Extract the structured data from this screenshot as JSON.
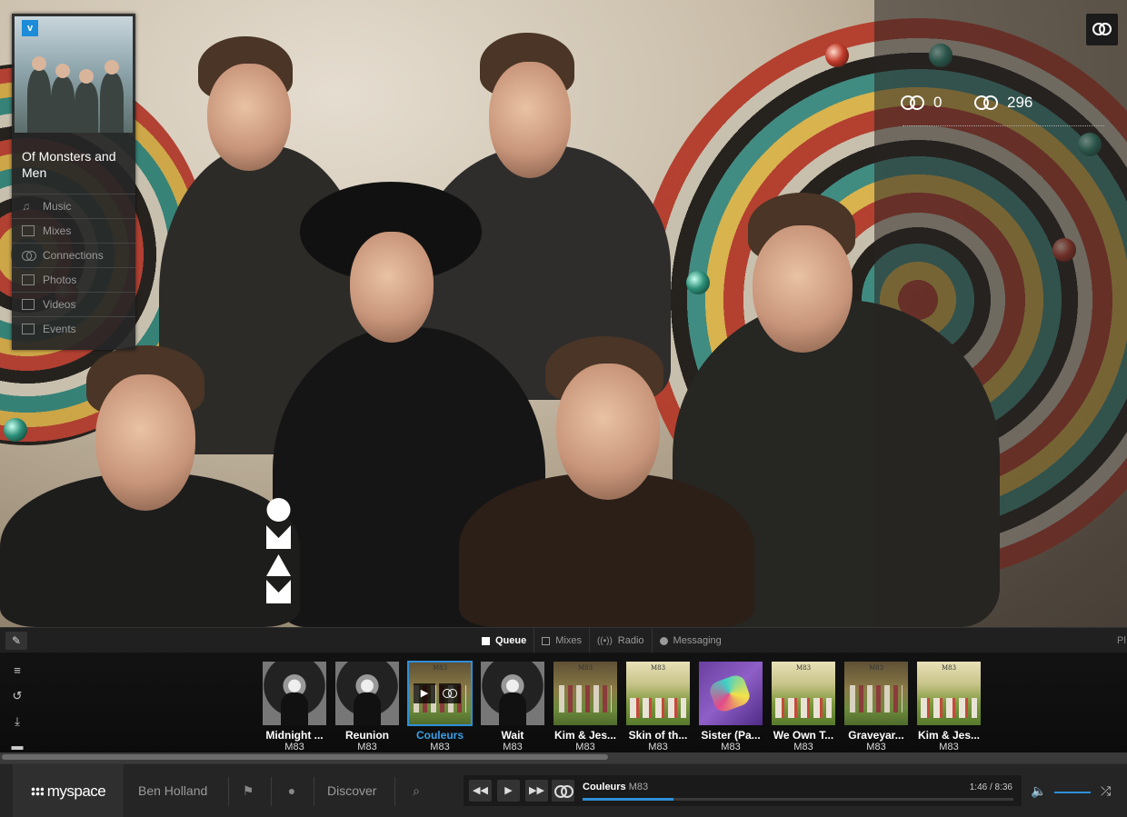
{
  "artist": {
    "name": "Of Monsters and Men",
    "verified_badge": "v",
    "nav": [
      {
        "label": "Music",
        "icon": "music-note-icon"
      },
      {
        "label": "Mixes",
        "icon": "mix-icon"
      },
      {
        "label": "Connections",
        "icon": "connections-icon"
      },
      {
        "label": "Photos",
        "icon": "photo-icon"
      },
      {
        "label": "Videos",
        "icon": "video-icon"
      },
      {
        "label": "Events",
        "icon": "calendar-icon"
      }
    ]
  },
  "stats": {
    "connections_left": "0",
    "connections_right": "296"
  },
  "panel": {
    "tabs": [
      {
        "label": "Queue",
        "active": true
      },
      {
        "label": "Mixes",
        "active": false
      },
      {
        "label": "Radio",
        "active": false
      },
      {
        "label": "Messaging",
        "active": false
      }
    ],
    "overflow_label": "Pl"
  },
  "queue": [
    {
      "title": "Midnight ...",
      "artist": "M83",
      "cover": "bw"
    },
    {
      "title": "Reunion",
      "artist": "M83",
      "cover": "bw"
    },
    {
      "title": "Couleurs",
      "artist": "M83",
      "cover": "field",
      "current": true
    },
    {
      "title": "Wait",
      "artist": "M83",
      "cover": "bw"
    },
    {
      "title": "Kim & Jes...",
      "artist": "M83",
      "cover": "field"
    },
    {
      "title": "Skin of th...",
      "artist": "M83",
      "cover": "picnic"
    },
    {
      "title": "Sister (Pa...",
      "artist": "M83",
      "cover": "purple"
    },
    {
      "title": "We Own T...",
      "artist": "M83",
      "cover": "picnic"
    },
    {
      "title": "Graveyar...",
      "artist": "M83",
      "cover": "field"
    },
    {
      "title": "Kim & Jes...",
      "artist": "M83",
      "cover": "picnic"
    }
  ],
  "cover_tag": "M83",
  "queue_scroll_position": 0.54,
  "bottom": {
    "logo": "myspace",
    "user": "Ben Holland",
    "discover": "Discover"
  },
  "player": {
    "title": "Couleurs",
    "artist": "M83",
    "time": "1:46 / 8:36",
    "progress": 0.21,
    "volume": 1.0
  },
  "colors": {
    "accent": "#2f8fd8",
    "current_track": "#3ba0e6"
  }
}
